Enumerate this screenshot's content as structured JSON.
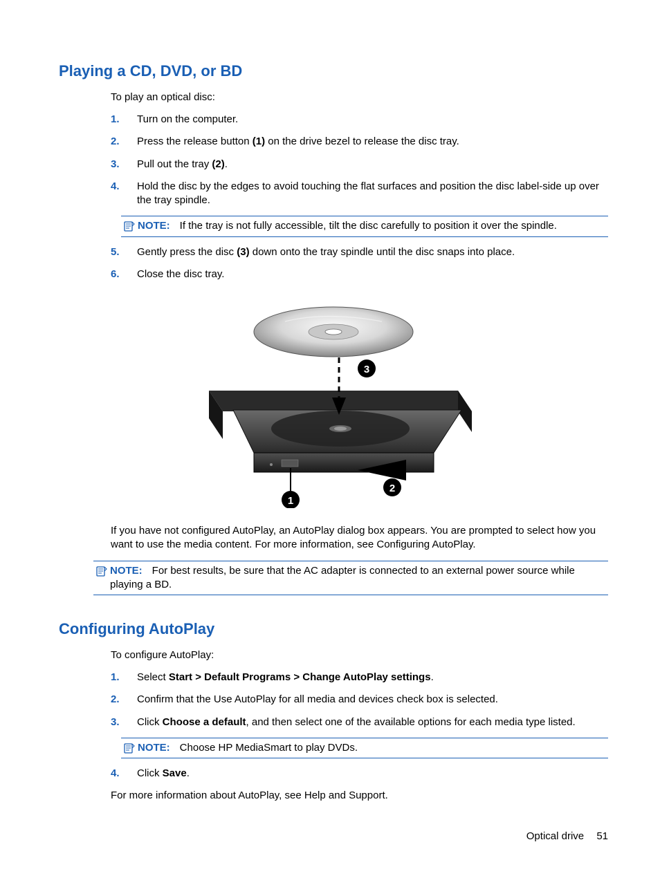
{
  "section1": {
    "heading": "Playing a CD, DVD, or BD",
    "intro": "To play an optical disc:",
    "steps": [
      {
        "num": "1.",
        "text": "Turn on the computer."
      },
      {
        "num": "2.",
        "pre": "Press the release button ",
        "bold": "(1)",
        "post": " on the drive bezel to release the disc tray."
      },
      {
        "num": "3.",
        "pre": "Pull out the tray ",
        "bold": "(2)",
        "post": "."
      },
      {
        "num": "4.",
        "text": "Hold the disc by the edges to avoid touching the flat surfaces and position the disc label-side up over the tray spindle."
      },
      {
        "num": "5.",
        "pre": "Gently press the disc ",
        "bold": "(3)",
        "post": " down onto the tray spindle until the disc snaps into place."
      },
      {
        "num": "6.",
        "text": "Close the disc tray."
      }
    ],
    "note1": {
      "label": "NOTE:",
      "text": "If the tray is not fully accessible, tilt the disc carefully to position it over the spindle."
    },
    "after_para": "If you have not configured AutoPlay, an AutoPlay dialog box appears. You are prompted to select how you want to use the media content. For more information, see Configuring AutoPlay.",
    "note2": {
      "label": "NOTE:",
      "text": "For best results, be sure that the AC adapter is connected to an external power source while playing a BD."
    }
  },
  "section2": {
    "heading": "Configuring AutoPlay",
    "intro": "To configure AutoPlay:",
    "steps": [
      {
        "num": "1.",
        "pre": "Select ",
        "bold": "Start > Default Programs > Change AutoPlay settings",
        "post": "."
      },
      {
        "num": "2.",
        "text": "Confirm that the Use AutoPlay for all media and devices check box is selected."
      },
      {
        "num": "3.",
        "pre": "Click ",
        "bold": "Choose a default",
        "post": ", and then select one of the available options for each media type listed."
      },
      {
        "num": "4.",
        "pre": "Click ",
        "bold": "Save",
        "post": "."
      }
    ],
    "note1": {
      "label": "NOTE:",
      "text": "Choose HP MediaSmart to play DVDs."
    },
    "after_para": "For more information about AutoPlay, see Help and Support."
  },
  "footer": {
    "section": "Optical drive",
    "page": "51"
  }
}
